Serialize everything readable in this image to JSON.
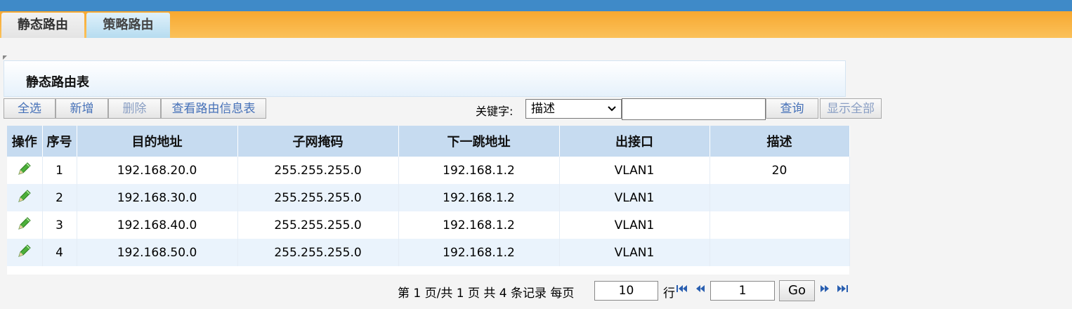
{
  "tabs": [
    {
      "label": "静态路由",
      "active": true
    },
    {
      "label": "策略路由",
      "active": false
    }
  ],
  "panel": {
    "title": "静态路由表"
  },
  "toolbar": {
    "select_all": "全选",
    "add": "新增",
    "delete": "删除",
    "view_route_info": "查看路由信息表",
    "keyword_label": "关键字:",
    "keyword_field": "描述",
    "search": "查询",
    "show_all": "显示全部"
  },
  "table": {
    "headers": [
      "操作",
      "序号",
      "目的地址",
      "子网掩码",
      "下一跳地址",
      "出接口",
      "描述"
    ],
    "rows": [
      {
        "seq": "1",
        "dest": "192.168.20.0",
        "mask": "255.255.255.0",
        "next_hop": "192.168.1.2",
        "iface": "VLAN1",
        "desc": "20"
      },
      {
        "seq": "2",
        "dest": "192.168.30.0",
        "mask": "255.255.255.0",
        "next_hop": "192.168.1.2",
        "iface": "VLAN1",
        "desc": ""
      },
      {
        "seq": "3",
        "dest": "192.168.40.0",
        "mask": "255.255.255.0",
        "next_hop": "192.168.1.2",
        "iface": "VLAN1",
        "desc": ""
      },
      {
        "seq": "4",
        "dest": "192.168.50.0",
        "mask": "255.255.255.0",
        "next_hop": "192.168.1.2",
        "iface": "VLAN1",
        "desc": ""
      }
    ]
  },
  "pager": {
    "summary": "第 1 页/共 1 页 共 4 条记录 每页",
    "per_page": "10",
    "rows_unit": "行",
    "page_input": "1",
    "go": "Go"
  },
  "colors": {
    "accent_blue": "#3f8ac8",
    "tab_orange": "#f7a830",
    "header_blue": "#c6dbf0",
    "link_blue": "#4671b8"
  },
  "icons": {
    "edit": "pencil-icon",
    "first": "first-page-icon",
    "prev": "prev-page-icon",
    "next": "next-page-icon",
    "last": "last-page-icon"
  }
}
